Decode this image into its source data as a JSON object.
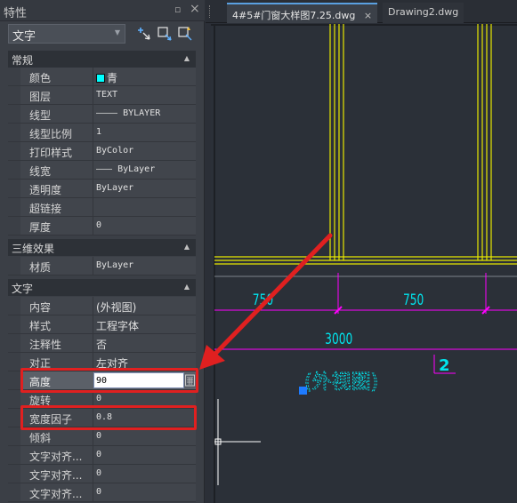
{
  "colors": {
    "accent_red": "#e02020",
    "cad_yellow": "#e8e800",
    "cad_magenta": "#ff00ff",
    "cad_cyan": "#00ffff",
    "panel_bg": "#3b3f46"
  },
  "panel": {
    "title": "特性",
    "title_icons": [
      "pin-icon",
      "close-icon"
    ],
    "object_type": "文字",
    "toolbar_icons": [
      "add-selection-icon",
      "select-objects-icon",
      "quick-select-icon"
    ],
    "sections": {
      "general": {
        "title": "常规",
        "rows": [
          {
            "label": "颜色",
            "value": "青"
          },
          {
            "label": "图层",
            "value": "TEXT"
          },
          {
            "label": "线型",
            "value": "———— BYLAYER"
          },
          {
            "label": "线型比例",
            "value": "1"
          },
          {
            "label": "打印样式",
            "value": "ByColor"
          },
          {
            "label": "线宽",
            "value": "——— ByLayer"
          },
          {
            "label": "透明度",
            "value": "ByLayer"
          },
          {
            "label": "超链接",
            "value": ""
          },
          {
            "label": "厚度",
            "value": "0"
          }
        ]
      },
      "3d": {
        "title": "三维效果",
        "rows": [
          {
            "label": "材质",
            "value": "ByLayer"
          }
        ]
      },
      "text": {
        "title": "文字",
        "rows": [
          {
            "label": "内容",
            "value": "(外视图)"
          },
          {
            "label": "样式",
            "value": "工程字体"
          },
          {
            "label": "注释性",
            "value": "否"
          },
          {
            "label": "对正",
            "value": "左对齐"
          },
          {
            "label": "高度",
            "value": "90"
          },
          {
            "label": "旋转",
            "value": "0"
          },
          {
            "label": "宽度因子",
            "value": "0.8"
          },
          {
            "label": "倾斜",
            "value": "0"
          },
          {
            "label": "文字对齐...",
            "value": "0"
          },
          {
            "label": "文字对齐...",
            "value": "0"
          },
          {
            "label": "文字对齐...",
            "value": "0"
          }
        ]
      }
    }
  },
  "tabs": [
    {
      "label": "4#5#门窗大样图7.25.dwg",
      "active": true
    },
    {
      "label": "Drawing2.dwg",
      "active": false
    }
  ],
  "drawing": {
    "dim_left": "750",
    "dim_right": "750",
    "dim_total": "3000",
    "label_text": "(外视图)",
    "marker_number": "2"
  }
}
